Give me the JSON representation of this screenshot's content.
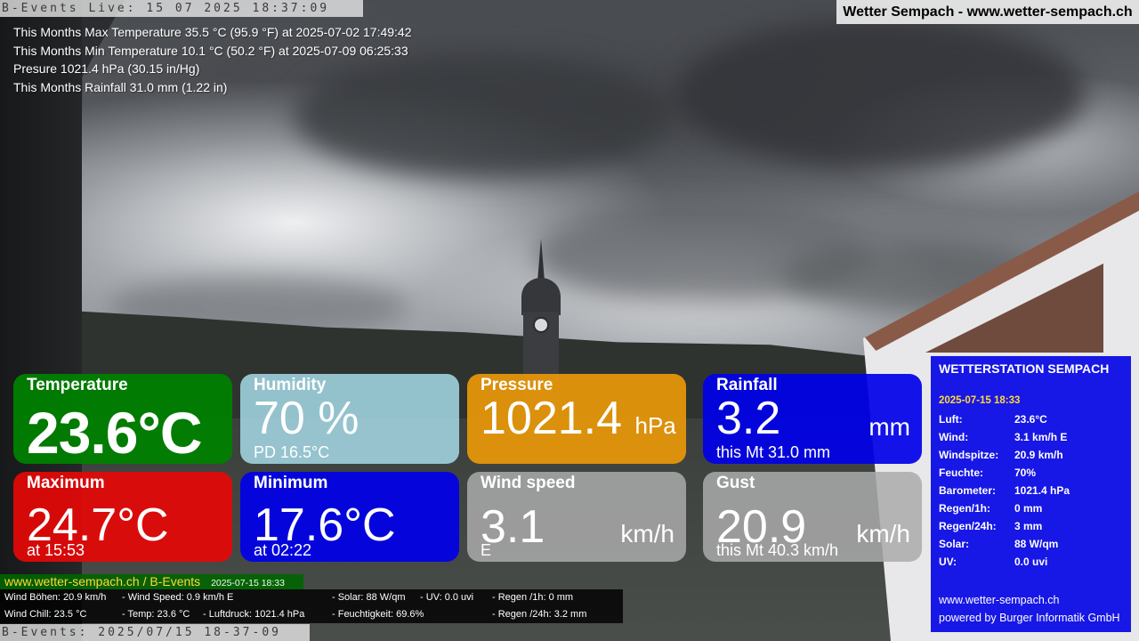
{
  "overlay": {
    "top_stamp": "B-Events Live: 15 07 2025 18:37:09",
    "site_title": "Wetter Sempach - www.wetter-sempach.ch",
    "bottom_stamp": "B-Events: 2025/07/15 18-37-09"
  },
  "stats": {
    "max_temp": "This Months Max Temperature 35.5 °C (95.9 °F) at 2025-07-02 17:49:42",
    "min_temp": "This Months Min Temperature 10.1 °C (50.2 °F) at 2025-07-09 06:25:33",
    "pressure": "Presure 1021.4 hPa (30.15 in/Hg)",
    "rainfall": "This Months Rainfall 31.0 mm (1.22 in)"
  },
  "tiles": {
    "temperature": {
      "title": "Temperature",
      "value": "23.6°C"
    },
    "humidity": {
      "title": "Humidity",
      "value": "70 %",
      "sub": "PD 16.5°C"
    },
    "pressure": {
      "title": "Pressure",
      "value": "1021.4",
      "unit": "hPa"
    },
    "rainfall": {
      "title": "Rainfall",
      "value": "3.2",
      "unit": "mm",
      "sub": "this Mt 31.0 mm"
    },
    "maximum": {
      "title": "Maximum",
      "value": "24.7°C",
      "sub": "at 15:53"
    },
    "minimum": {
      "title": "Minimum",
      "value": "17.6°C",
      "sub": "at 02:22"
    },
    "wind_speed": {
      "title": "Wind speed",
      "value": "3.1",
      "unit": "km/h",
      "sub": "E"
    },
    "gust": {
      "title": "Gust",
      "value": "20.9",
      "unit": "km/h",
      "sub": "this Mt 40.3 km/h"
    }
  },
  "station": {
    "title": "WETTERSTATION SEMPACH",
    "date": "2025-07-15 18:33",
    "rows": [
      {
        "key": "Luft:",
        "value": "23.6°C"
      },
      {
        "key": "Wind:",
        "value": "3.1 km/h  E"
      },
      {
        "key": "Windspitze:",
        "value": "20.9 km/h"
      },
      {
        "key": "Feuchte:",
        "value": "70%"
      },
      {
        "key": "Barometer:",
        "value": "1021.4 hPa"
      },
      {
        "key": "Regen/1h:",
        "value": "0 mm"
      },
      {
        "key": "Regen/24h:",
        "value": "3 mm"
      },
      {
        "key": "Solar:",
        "value": "88 W/qm"
      },
      {
        "key": "UV:",
        "value": "0.0 uvi"
      }
    ],
    "footer_url": "www.wetter-sempach.ch",
    "footer_credit": "powered by Burger Informatik GmbH"
  },
  "ticker": {
    "link": "www.wetter-sempach.ch / B-Events",
    "date": "2025-07-15 18:33",
    "wind_gusts": "Wind Böhen: 20.9 km/h",
    "wind_speed": "- Wind Speed: 0.9 km/h E",
    "solar": "- Solar: 88 W/qm",
    "uv": "- UV: 0.0 uvi",
    "rain_1h": "- Regen /1h:   0 mm",
    "wind_chill": "Wind Chill: 23.5 °C",
    "temp": "- Temp: 23.6 °C",
    "pressure": "- Luftdruck: 1021.4 hPa",
    "humidity": "- Feuchtigkeit: 69.6%",
    "rain_24h": "- Regen /24h: 3.2 mm"
  },
  "colors": {
    "temperature": "#008000",
    "humidity": "#A0D2DE",
    "pressure": "#E4960A",
    "rainfall": "#0000E8",
    "maximum": "#E60808",
    "minimum": "#0000E8",
    "wind": "#AAAAAC",
    "station_panel": "#0000E6",
    "accent_yellow": "#FFD93A"
  }
}
